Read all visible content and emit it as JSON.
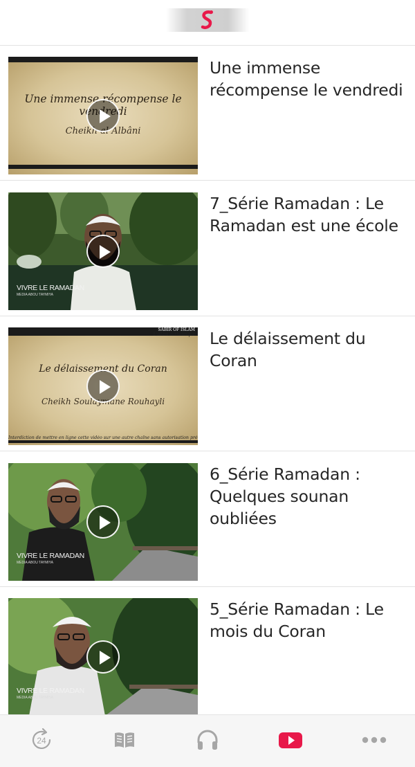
{
  "header": {
    "logo_icon": "s-logo-icon",
    "brand_color": "#e8194a"
  },
  "videos": [
    {
      "title": "Une immense récompense le vendredi",
      "thumb": {
        "style": "parchment",
        "heading": "Une immense récompense le vendredi",
        "subtitle": "Cheikh al Albâni"
      }
    },
    {
      "title": "7_Série Ramadan : Le Ramadan est une école",
      "thumb": {
        "style": "nature",
        "caption": "VIVRE LE RAMADAN",
        "caption_small": "MEDIA ABOU TAYMIYA"
      }
    },
    {
      "title": "Le délaissement du Coran",
      "thumb": {
        "style": "parchment",
        "heading": "Le délaissement du Coran",
        "subtitle": "Cheikh Soulaymane Rouhayli",
        "brand": "SABIR OF ISLAM",
        "brand_sub": "L'islam authentique",
        "note": "Interdiction de mettre en ligne cette vidéo sur une autre chaîne sans autorisation préalable"
      }
    },
    {
      "title": "6_Série Ramadan : Quelques sounan oubliées",
      "thumb": {
        "style": "nature",
        "caption": "VIVRE LE RAMADAN",
        "caption_small": "MEDIA ABOU TAYMIYA"
      }
    },
    {
      "title": "5_Série Ramadan : Le mois du Coran",
      "thumb": {
        "style": "nature",
        "caption": "VIVRE LE RAMADAN",
        "caption_small": "MEDIA ABOU TAYMIYA"
      }
    }
  ],
  "tabbar": {
    "tabs": [
      {
        "icon": "clock-24-icon",
        "label": "24"
      },
      {
        "icon": "book-icon"
      },
      {
        "icon": "headphones-icon"
      },
      {
        "icon": "youtube-icon",
        "active": true,
        "color": "#e8194a"
      },
      {
        "icon": "more-dots-icon"
      }
    ],
    "inactive_color": "#a6a6a6"
  }
}
